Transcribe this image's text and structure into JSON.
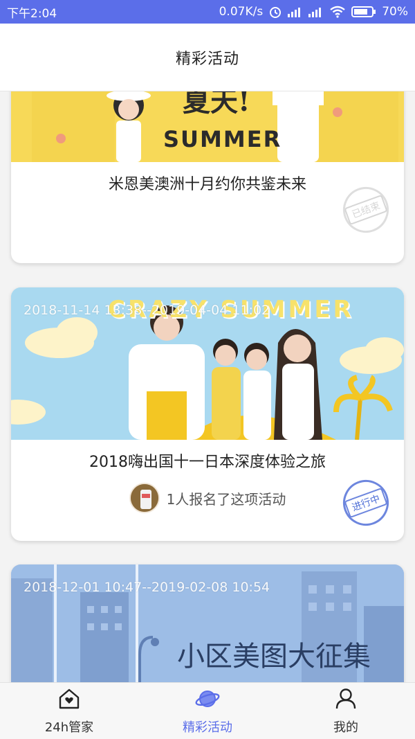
{
  "status_bar": {
    "time": "下午2:04",
    "network_speed": "0.07K/s",
    "battery": "70%",
    "icons": [
      "alarm-icon",
      "signal-icon",
      "signal-icon",
      "wifi-icon",
      "battery-icon"
    ]
  },
  "header": {
    "title": "精彩活动"
  },
  "activities": [
    {
      "date": "",
      "title": "米恩美澳洲十月约你共鉴未来",
      "banner_text": [
        "夏天!",
        "SUMMER"
      ],
      "status": "已结束"
    },
    {
      "date": "2018-11-14 13:38--2019-04-04 11:02",
      "title": "2018嗨出国十一日本深度体验之旅",
      "banner_text": [
        "CRAZY SUMMER"
      ],
      "signup_text": "1人报名了这项活动",
      "status": "进行中"
    },
    {
      "date": "2018-12-01 10:47--2019-02-08 10:54",
      "banner_text": [
        "小区美图大征集"
      ]
    }
  ],
  "tab_bar": {
    "items": [
      {
        "label": "24h管家",
        "icon": "home-heart-icon"
      },
      {
        "label": "精彩活动",
        "icon": "planet-icon",
        "active": true
      },
      {
        "label": "我的",
        "icon": "user-icon"
      }
    ]
  },
  "colors": {
    "primary": "#5b6ee9",
    "banner_yellow": "#f7d958",
    "banner_sky": "#a9d9f0",
    "banner_blue": "#9dbde6"
  }
}
